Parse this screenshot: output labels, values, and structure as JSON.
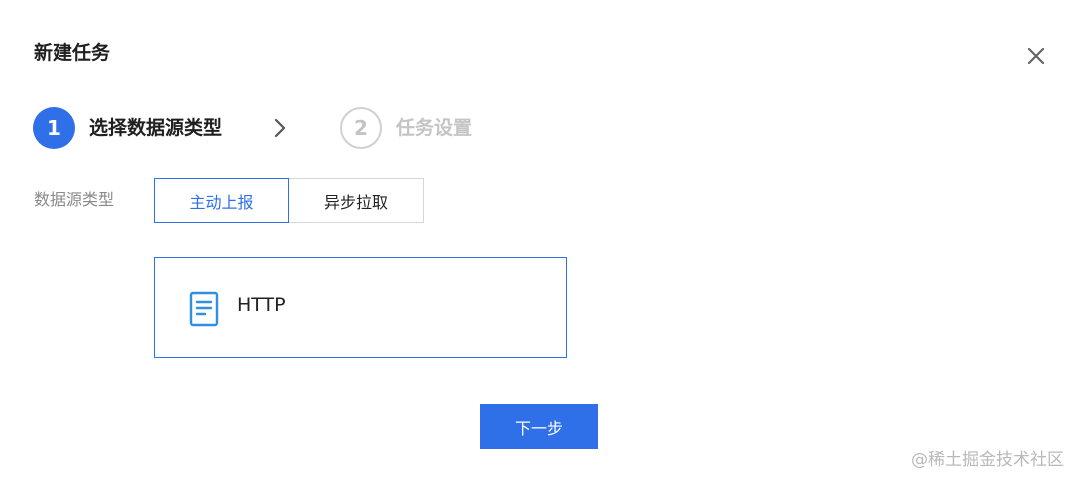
{
  "dialog": {
    "title": "新建任务",
    "close_icon": "close-icon"
  },
  "steps": [
    {
      "number": "1",
      "label": "选择数据源类型",
      "state": "active"
    },
    {
      "number": "2",
      "label": "任务设置",
      "state": "inactive"
    }
  ],
  "step_separator_icon": "chevron-right-icon",
  "form": {
    "field_label": "数据源类型",
    "options": [
      {
        "label": "主动上报",
        "selected": true
      },
      {
        "label": "异步拉取",
        "selected": false
      }
    ],
    "source_card": {
      "icon": "document-icon",
      "label": "HTTP",
      "selected": true
    }
  },
  "actions": {
    "next_label": "下一步"
  },
  "watermark": "@稀土掘金技术社区",
  "colors": {
    "primary": "#2f6fe8",
    "text": "#222222",
    "muted": "#8a8a8a",
    "inactive": "#c4c4c4"
  }
}
